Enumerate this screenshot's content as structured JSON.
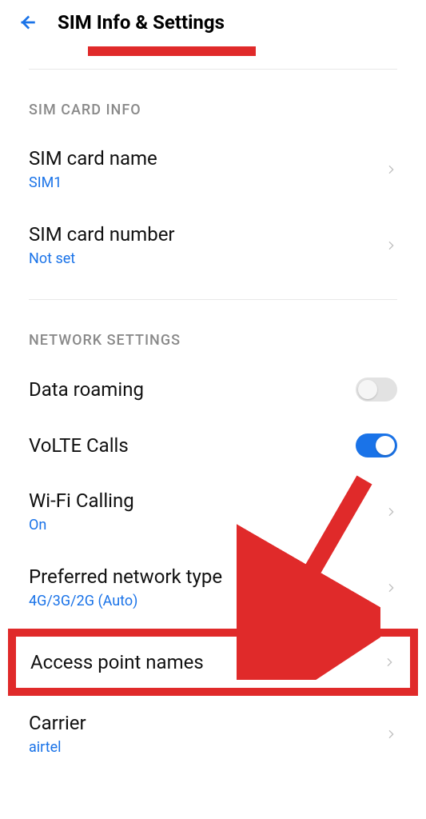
{
  "header": {
    "title": "SIM Info & Settings"
  },
  "sections": {
    "sim_info": {
      "header": "SIM CARD INFO",
      "name": {
        "label": "SIM card name",
        "value": "SIM1"
      },
      "number": {
        "label": "SIM card number",
        "value": "Not set"
      }
    },
    "network": {
      "header": "NETWORK SETTINGS",
      "roaming": {
        "label": "Data roaming",
        "on": false
      },
      "volte": {
        "label": "VoLTE Calls",
        "on": true
      },
      "wifi": {
        "label": "Wi-Fi Calling",
        "value": "On"
      },
      "pref": {
        "label": "Preferred network type",
        "value": "4G/3G/2G (Auto)"
      },
      "apn": {
        "label": "Access point names"
      },
      "carrier": {
        "label": "Carrier",
        "value": "airtel"
      }
    }
  }
}
